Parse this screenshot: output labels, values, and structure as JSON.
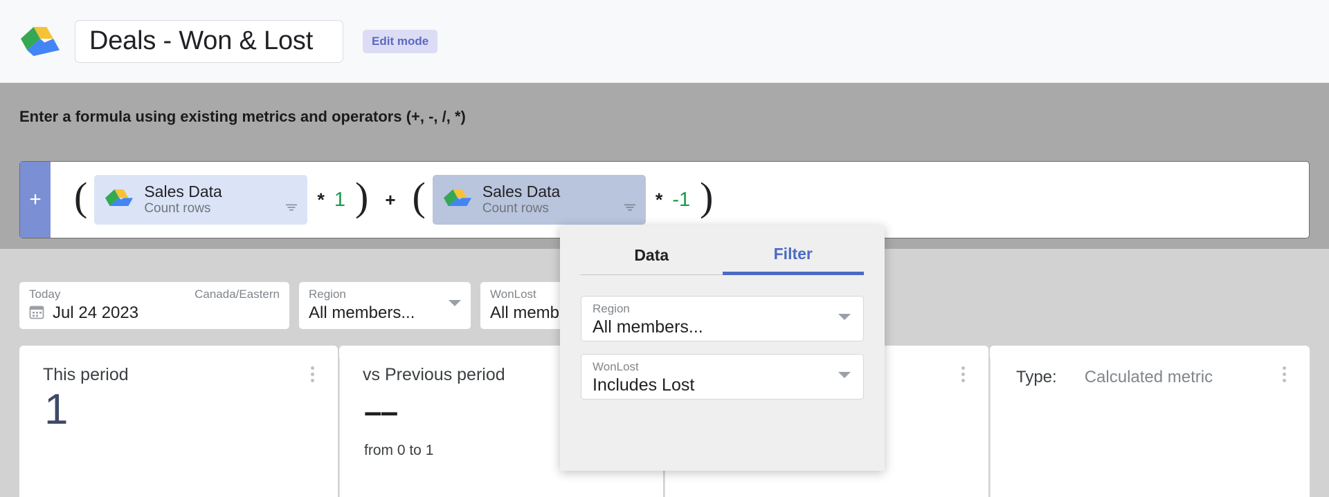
{
  "header": {
    "logo_icon": "google-drive-icon",
    "title": "Deals - Won & Lost",
    "badge": "Edit mode"
  },
  "formula": {
    "hint": "Enter a formula using existing metrics and operators (+, -, /, *)",
    "add_label": "+",
    "open_paren": "(",
    "close_paren": ")",
    "terms": [
      {
        "chip_title": "Sales Data",
        "chip_sub": "Count rows",
        "chip_icon": "google-drive-icon",
        "filter_icon": "filter-icon",
        "operator": "*",
        "value": "1",
        "selected": false
      },
      {
        "chip_title": "Sales Data",
        "chip_sub": "Count rows",
        "chip_icon": "google-drive-icon",
        "filter_icon": "filter-icon",
        "operator": "*",
        "value": "-1",
        "selected": true
      }
    ],
    "join_operator": "+"
  },
  "filterbar": {
    "date": {
      "label": "Today",
      "timezone": "Canada/Eastern",
      "value": "Jul 24 2023",
      "icon": "calendar-icon"
    },
    "region": {
      "label": "Region",
      "value": "All members..."
    },
    "wonlost": {
      "label": "WonLost",
      "value": "All memb"
    }
  },
  "popup": {
    "tabs": [
      {
        "label": "Data",
        "active": false
      },
      {
        "label": "Filter",
        "active": true
      }
    ],
    "fields": [
      {
        "label": "Region",
        "value": "All members..."
      },
      {
        "label": "WonLost",
        "value": "Includes Lost"
      }
    ]
  },
  "cards": [
    {
      "heading": "This period",
      "big": "1",
      "sub": ""
    },
    {
      "heading": "vs Previous period",
      "dash": "––",
      "sub": "from 0 to 1"
    },
    {
      "heading": "",
      "big": "",
      "sub": ""
    }
  ],
  "type_card": {
    "label": "Type:",
    "value": "Calculated metric"
  },
  "colors": {
    "accent": "#4c6ac4",
    "band": "#a9a9a9",
    "filterbar": "#d2d2d2",
    "chip": "#dbe4f7",
    "chip_selected": "#b9c4dd",
    "number_green": "#1a9a4a",
    "badge_bg": "#dcdcf5",
    "badge_text": "#5b6abf"
  }
}
